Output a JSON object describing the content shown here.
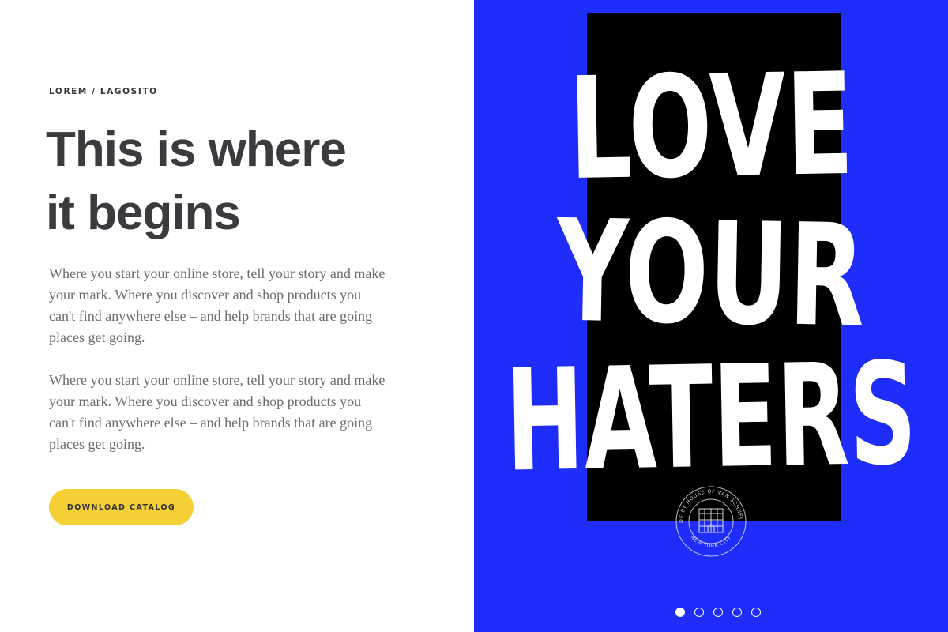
{
  "breadcrumb": "LOREM / LAGOSITO",
  "title": {
    "line1": "This is where",
    "line2": "it begins"
  },
  "paragraphs": [
    "Where you start your online store, tell your story and make your mark. Where you discover and shop products you can't find anywhere else – and help brands that are going places get going.",
    "Where you start your online store, tell your story and make your mark. Where you discover and shop products you can't find anywhere else – and help brands that are going places get going."
  ],
  "cta": {
    "label": "DOWNLOAD CATALOG"
  },
  "poster": {
    "line1": "LOVE",
    "line2": "YOUR",
    "line3": "HATERS",
    "seal_top_text": "MADE BY HOUSE OF VAN SCHNEIDER",
    "seal_bottom_text": "NEW YORK CITY"
  },
  "carousel": {
    "total": 5,
    "active_index": 0
  },
  "colors": {
    "accent_yellow": "#f4d035",
    "poster_blue": "#1f2dfb",
    "title_gray": "#3a3a3f",
    "body_gray": "#6b6b6b"
  }
}
